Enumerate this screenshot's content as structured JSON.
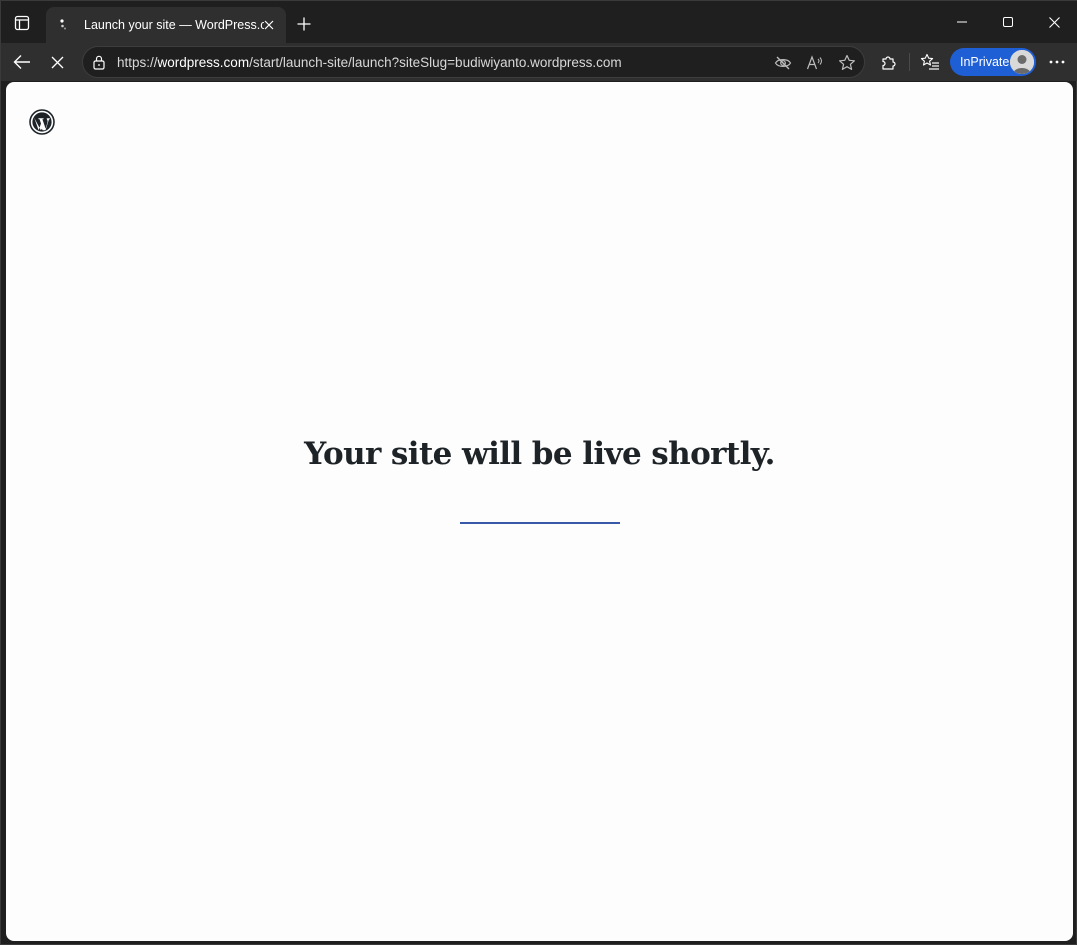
{
  "browser": {
    "tab": {
      "title": "Launch your site — WordPress.co"
    },
    "address": {
      "url_prefix": "https://",
      "url_host": "wordpress.com",
      "url_path": "/start/launch-site/launch?siteSlug=budiwiyanto.wordpress.com"
    },
    "profile": {
      "label": "InPrivate"
    },
    "colors": {
      "inprivate": "#1f5fd6",
      "chrome_dark": "#1f1f1f",
      "toolbar": "#2f2f2f"
    }
  },
  "page": {
    "logo": "wordpress-logo",
    "headline": "Your site will be live shortly.",
    "progress": 1.0,
    "colors": {
      "text": "#1d2327",
      "accent": "#3858a8"
    }
  }
}
